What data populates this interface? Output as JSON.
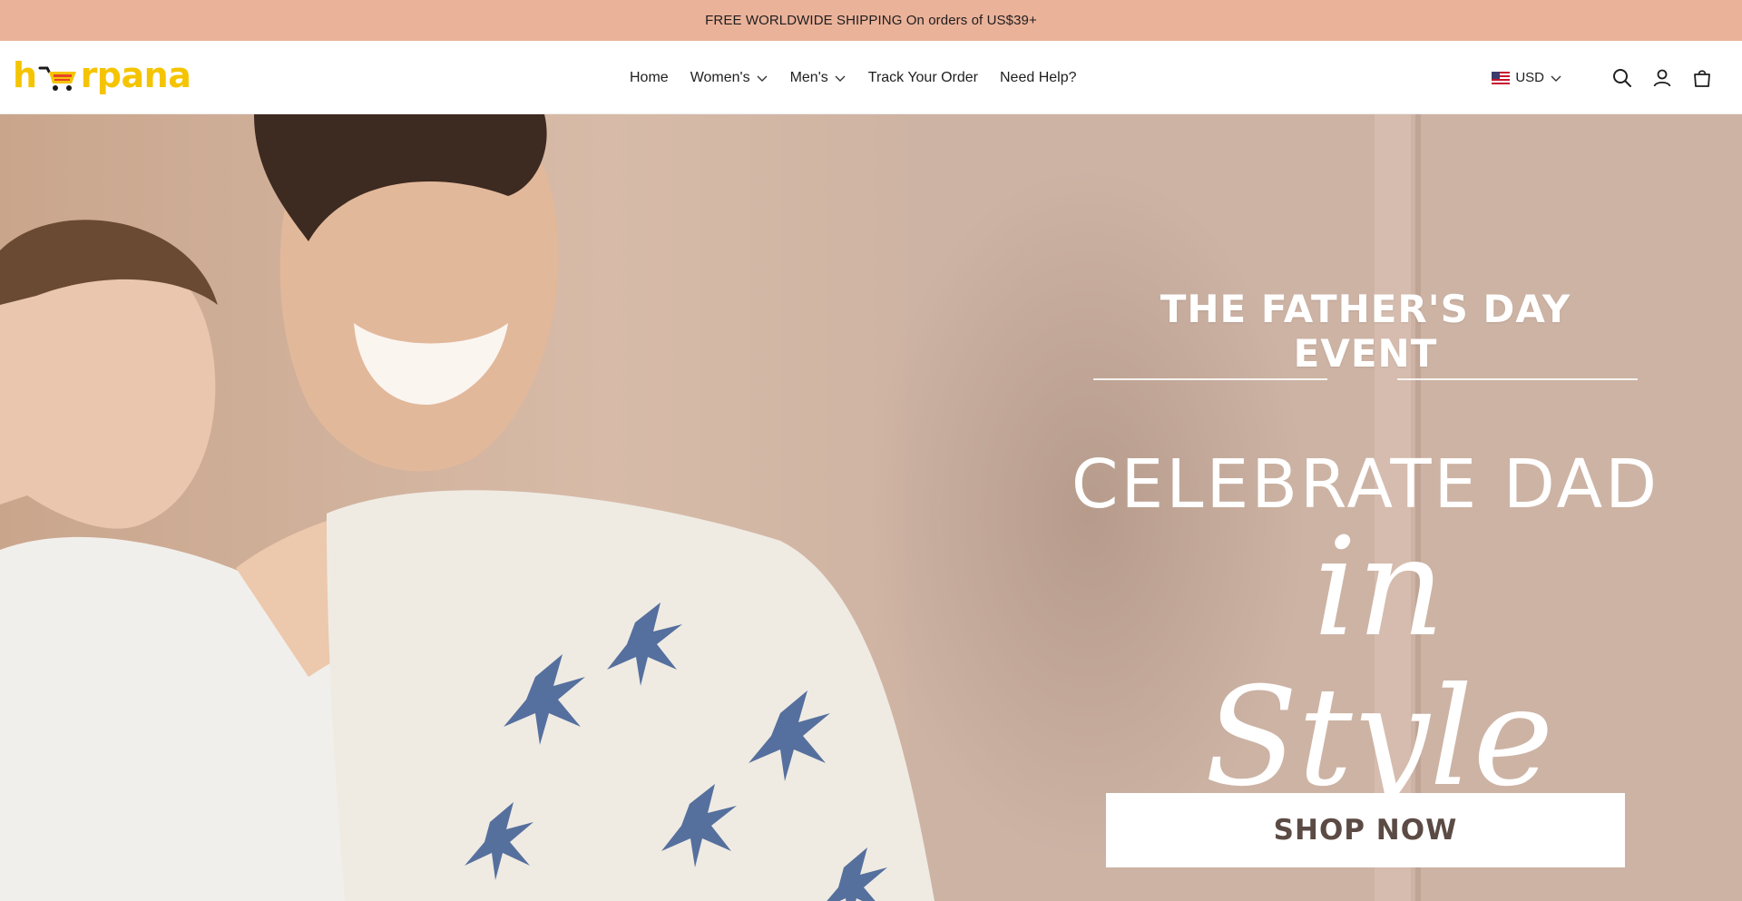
{
  "announcement": {
    "text": "FREE WORLDWIDE SHIPPING On orders of US$39+"
  },
  "logo": {
    "prefix": "h",
    "suffix": "rpana",
    "color": "#f5c400"
  },
  "nav": {
    "home": "Home",
    "womens": "Women's",
    "mens": "Men's",
    "track": "Track Your Order",
    "help": "Need Help?"
  },
  "currency": {
    "code": "USD",
    "flag_icon": "us-flag-icon"
  },
  "header_icons": [
    "search-icon",
    "account-icon",
    "cart-bag-icon"
  ],
  "hero": {
    "title": "THE  FATHER'S DAY EVENT",
    "subtitle": "CELEBRATE DAD",
    "script": "in Style",
    "button": "SHOP NOW"
  },
  "colors": {
    "announcement_bg": "#ebb29a",
    "logo_yellow": "#f5c400",
    "button_text": "#5b4b44"
  }
}
